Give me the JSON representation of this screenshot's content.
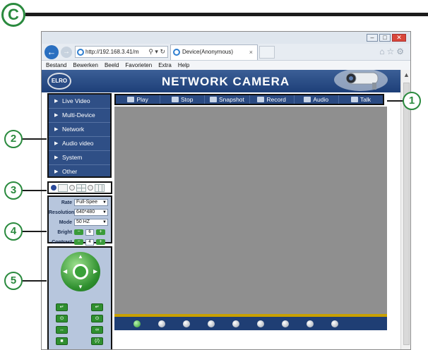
{
  "manual": {
    "section_letter": "C",
    "callouts": [
      "1",
      "2",
      "3",
      "4",
      "5"
    ]
  },
  "browser": {
    "address": "http://192.168.3.41/m",
    "tab_title": "Device(Anonymous)",
    "tab_close": "×",
    "menu": [
      "Bestand",
      "Bewerken",
      "Beeld",
      "Favorieten",
      "Extra",
      "Help"
    ]
  },
  "camera": {
    "logo": "ELRO",
    "title": "NETWORK CAMERA",
    "left_menu": [
      "Live Video",
      "Multi-Device",
      "Network",
      "Audio video",
      "System",
      "Other"
    ],
    "toolbar": [
      "Play",
      "Stop",
      "Snapshot",
      "Record",
      "Audio",
      "Talk"
    ],
    "layout_selected": 0,
    "settings": {
      "rate_label": "Rate",
      "rate_value": "Full-Spee",
      "resolution_label": "Resolution",
      "resolution_value": "640*480",
      "mode_label": "Mode",
      "mode_value": "50 HZ",
      "bright_label": "Bright",
      "bright_value": "6",
      "contrast_label": "Contrast",
      "contrast_value": "4"
    },
    "camera_channels": 9,
    "active_channel": 0
  }
}
